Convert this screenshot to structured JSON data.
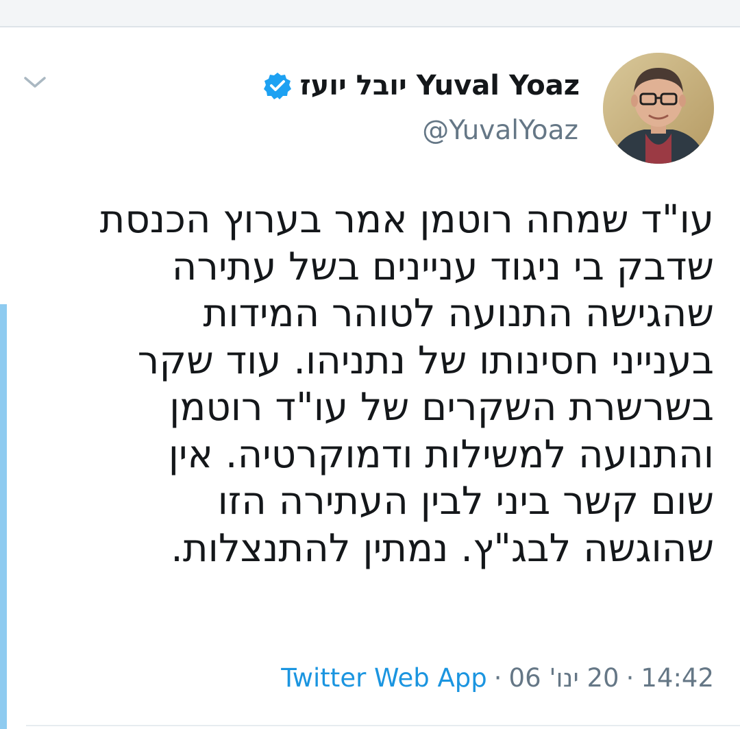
{
  "user": {
    "display_name": "יובל יועז Yuval Yoaz",
    "handle": "@YuvalYoaz",
    "verified": true
  },
  "icons": {
    "menu": "chevron-down-icon",
    "verified": "verified-badge-icon"
  },
  "colors": {
    "link_blue": "#1b95e0",
    "verified_blue": "#1da1f2",
    "meta_gray": "#657786"
  },
  "tweet": {
    "lines": [
      "עו\"ד שמחה רוטמן אמר בערוץ הכנסת",
      "שדבק בי ניגוד עניינים בשל עתירה",
      "שהגישה התנועה לטוהר המידות",
      "בענייני חסינותו של נתניהו. עוד שקר",
      "בשרשרת השקרים של עו\"ד רוטמן",
      "והתנועה למשילות ודמוקרטיה. אין",
      "שום קשר ביני לבין העתירה הזו",
      "שהוגשה לבג\"ץ. נמתין להתנצלות."
    ]
  },
  "meta": {
    "time": "14:42",
    "date": "20 ינו' 06",
    "source": "Twitter Web App",
    "separator": "·"
  }
}
